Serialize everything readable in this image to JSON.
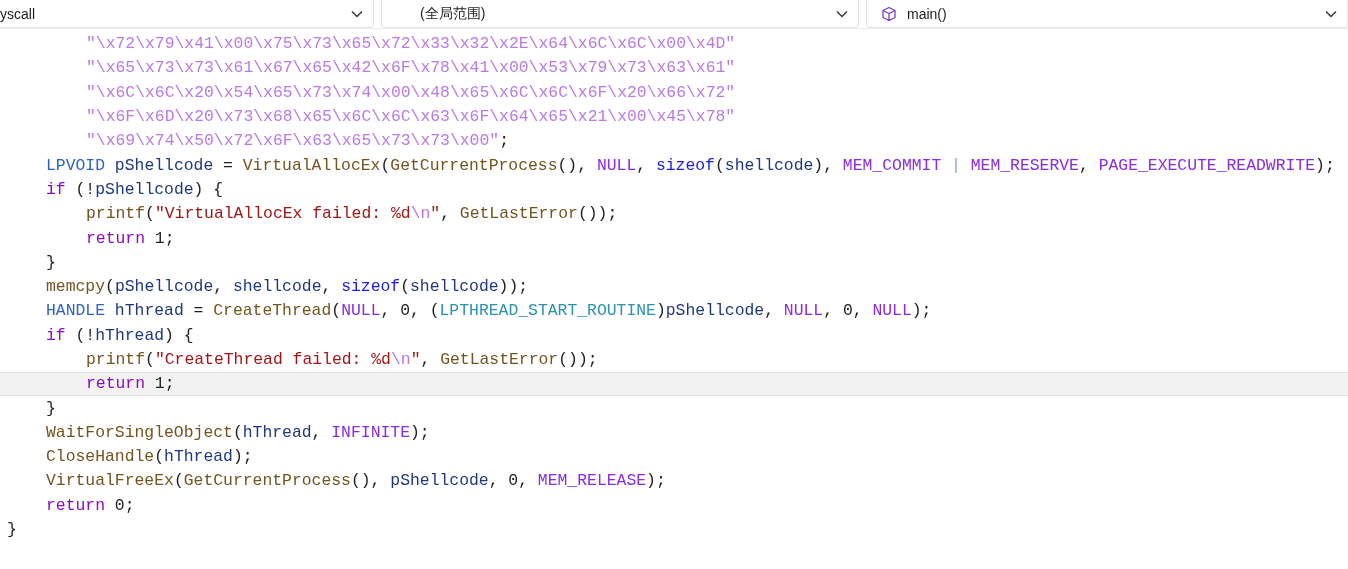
{
  "nav_bar": {
    "dropdowns": [
      {
        "kind": "project",
        "value": "yscall"
      },
      {
        "kind": "scope",
        "value": "(全局范围)"
      },
      {
        "kind": "member",
        "value": "main()"
      }
    ]
  },
  "editor": {
    "lines": [
      {
        "kind": "inner",
        "current": false,
        "tokens": [
          {
            "kind": "escape",
            "text": "\"\\x72\\x79\\x41\\x00\\x75\\x73\\x65\\x72\\x33\\x32\\x2E\\x64\\x6C\\x6C\\x00\\x4D\""
          }
        ]
      },
      {
        "kind": "inner",
        "current": false,
        "tokens": [
          {
            "kind": "escape",
            "text": "\"\\x65\\x73\\x73\\x61\\x67\\x65\\x42\\x6F\\x78\\x41\\x00\\x53\\x79\\x73\\x63\\x61\""
          }
        ]
      },
      {
        "kind": "inner",
        "current": false,
        "tokens": [
          {
            "kind": "escape",
            "text": "\"\\x6C\\x6C\\x20\\x54\\x65\\x73\\x74\\x00\\x48\\x65\\x6C\\x6C\\x6F\\x20\\x66\\x72\""
          }
        ]
      },
      {
        "kind": "inner",
        "current": false,
        "tokens": [
          {
            "kind": "escape",
            "text": "\"\\x6F\\x6D\\x20\\x73\\x68\\x65\\x6C\\x6C\\x63\\x6F\\x64\\x65\\x21\\x00\\x45\\x78\""
          }
        ]
      },
      {
        "kind": "inner",
        "current": false,
        "tokens": [
          {
            "kind": "escape",
            "text": "\"\\x69\\x74\\x50\\x72\\x6F\\x63\\x65\\x73\\x73\\x00\""
          },
          {
            "kind": "plain",
            "text": ";"
          }
        ]
      },
      {
        "kind": "block",
        "current": false,
        "tokens": [
          {
            "kind": "type",
            "text": "LPVOID"
          },
          {
            "kind": "var",
            "text": " pShellcode"
          },
          {
            "kind": "plain",
            "text": " = "
          },
          {
            "kind": "func",
            "text": "VirtualAllocEx"
          },
          {
            "kind": "plain",
            "text": "("
          },
          {
            "kind": "func",
            "text": "GetCurrentProcess"
          },
          {
            "kind": "plain",
            "text": "(), "
          },
          {
            "kind": "macro",
            "text": "NULL"
          },
          {
            "kind": "plain",
            "text": ", "
          },
          {
            "kind": "keyword",
            "text": "sizeof"
          },
          {
            "kind": "plain",
            "text": "("
          },
          {
            "kind": "var",
            "text": "shellcode"
          },
          {
            "kind": "plain",
            "text": "), "
          },
          {
            "kind": "macro",
            "text": "MEM_COMMIT"
          },
          {
            "kind": "operator",
            "text": " | "
          },
          {
            "kind": "macro",
            "text": "MEM_RESERVE"
          },
          {
            "kind": "plain",
            "text": ", "
          },
          {
            "kind": "macro",
            "text": "PAGE_EXECUTE_READWRITE"
          },
          {
            "kind": "plain",
            "text": ");"
          }
        ]
      },
      {
        "kind": "block",
        "current": false,
        "tokens": [
          {
            "kind": "control",
            "text": "if"
          },
          {
            "kind": "plain",
            "text": " (!"
          },
          {
            "kind": "var",
            "text": "pShellcode"
          },
          {
            "kind": "plain",
            "text": ") {"
          }
        ]
      },
      {
        "kind": "inner",
        "current": false,
        "tokens": [
          {
            "kind": "func",
            "text": "printf"
          },
          {
            "kind": "plain",
            "text": "("
          },
          {
            "kind": "string",
            "text": "\"VirtualAllocEx failed: %d"
          },
          {
            "kind": "escape",
            "text": "\\n"
          },
          {
            "kind": "string",
            "text": "\""
          },
          {
            "kind": "plain",
            "text": ", "
          },
          {
            "kind": "func",
            "text": "GetLastError"
          },
          {
            "kind": "plain",
            "text": "());"
          }
        ]
      },
      {
        "kind": "inner",
        "current": false,
        "tokens": [
          {
            "kind": "control",
            "text": "return"
          },
          {
            "kind": "plain",
            "text": " 1;"
          }
        ]
      },
      {
        "kind": "block",
        "current": false,
        "tokens": [
          {
            "kind": "plain",
            "text": "}"
          }
        ]
      },
      {
        "kind": "block",
        "current": false,
        "tokens": [
          {
            "kind": "func",
            "text": "memcpy"
          },
          {
            "kind": "plain",
            "text": "("
          },
          {
            "kind": "var",
            "text": "pShellcode"
          },
          {
            "kind": "plain",
            "text": ", "
          },
          {
            "kind": "var",
            "text": "shellcode"
          },
          {
            "kind": "plain",
            "text": ", "
          },
          {
            "kind": "keyword",
            "text": "sizeof"
          },
          {
            "kind": "plain",
            "text": "("
          },
          {
            "kind": "var",
            "text": "shellcode"
          },
          {
            "kind": "plain",
            "text": "));"
          }
        ]
      },
      {
        "kind": "block",
        "current": false,
        "tokens": [
          {
            "kind": "type",
            "text": "HANDLE"
          },
          {
            "kind": "var",
            "text": " hThread"
          },
          {
            "kind": "plain",
            "text": " = "
          },
          {
            "kind": "func",
            "text": "CreateThread"
          },
          {
            "kind": "plain",
            "text": "("
          },
          {
            "kind": "macro",
            "text": "NULL"
          },
          {
            "kind": "plain",
            "text": ", 0, ("
          },
          {
            "kind": "class",
            "text": "LPTHREAD_START_ROUTINE"
          },
          {
            "kind": "plain",
            "text": ")"
          },
          {
            "kind": "var",
            "text": "pShellcode"
          },
          {
            "kind": "plain",
            "text": ", "
          },
          {
            "kind": "macro",
            "text": "NULL"
          },
          {
            "kind": "plain",
            "text": ", 0, "
          },
          {
            "kind": "macro",
            "text": "NULL"
          },
          {
            "kind": "plain",
            "text": ");"
          }
        ]
      },
      {
        "kind": "block",
        "current": false,
        "tokens": [
          {
            "kind": "control",
            "text": "if"
          },
          {
            "kind": "plain",
            "text": " (!"
          },
          {
            "kind": "var",
            "text": "hThread"
          },
          {
            "kind": "plain",
            "text": ") {"
          }
        ]
      },
      {
        "kind": "inner",
        "current": false,
        "tokens": [
          {
            "kind": "func",
            "text": "printf"
          },
          {
            "kind": "plain",
            "text": "("
          },
          {
            "kind": "string",
            "text": "\"CreateThread failed: %d"
          },
          {
            "kind": "escape",
            "text": "\\n"
          },
          {
            "kind": "string",
            "text": "\""
          },
          {
            "kind": "plain",
            "text": ", "
          },
          {
            "kind": "func",
            "text": "GetLastError"
          },
          {
            "kind": "plain",
            "text": "());"
          }
        ]
      },
      {
        "kind": "inner",
        "current": true,
        "tokens": [
          {
            "kind": "control",
            "text": "return"
          },
          {
            "kind": "plain",
            "text": " 1;"
          }
        ]
      },
      {
        "kind": "block",
        "current": false,
        "tokens": [
          {
            "kind": "plain",
            "text": "}"
          }
        ]
      },
      {
        "kind": "block",
        "current": false,
        "tokens": [
          {
            "kind": "func",
            "text": "WaitForSingleObject"
          },
          {
            "kind": "plain",
            "text": "("
          },
          {
            "kind": "var",
            "text": "hThread"
          },
          {
            "kind": "plain",
            "text": ", "
          },
          {
            "kind": "macro",
            "text": "INFINITE"
          },
          {
            "kind": "plain",
            "text": ");"
          }
        ]
      },
      {
        "kind": "block",
        "current": false,
        "tokens": [
          {
            "kind": "func",
            "text": "CloseHandle"
          },
          {
            "kind": "plain",
            "text": "("
          },
          {
            "kind": "var",
            "text": "hThread"
          },
          {
            "kind": "plain",
            "text": ");"
          }
        ]
      },
      {
        "kind": "block",
        "current": false,
        "tokens": [
          {
            "kind": "func",
            "text": "VirtualFreeEx"
          },
          {
            "kind": "plain",
            "text": "("
          },
          {
            "kind": "func",
            "text": "GetCurrentProcess"
          },
          {
            "kind": "plain",
            "text": "(), "
          },
          {
            "kind": "var",
            "text": "pShellcode"
          },
          {
            "kind": "plain",
            "text": ", 0, "
          },
          {
            "kind": "macro",
            "text": "MEM_RELEASE"
          },
          {
            "kind": "plain",
            "text": ");"
          }
        ]
      },
      {
        "kind": "block",
        "current": false,
        "tokens": [
          {
            "kind": "control",
            "text": "return"
          },
          {
            "kind": "plain",
            "text": " 0;"
          }
        ]
      },
      {
        "kind": "top",
        "current": false,
        "tokens": [
          {
            "kind": "plain",
            "text": "}"
          }
        ]
      }
    ]
  }
}
